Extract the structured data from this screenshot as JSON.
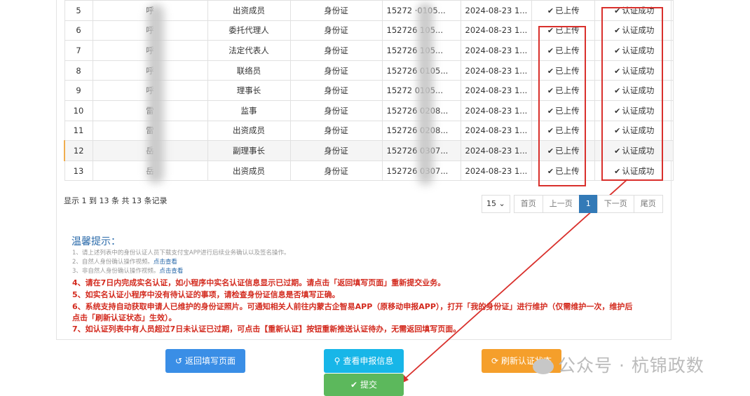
{
  "table": {
    "rows": [
      {
        "no": "5",
        "name": "呼",
        "role": "出资成员",
        "idtype": "身份证",
        "idno": "15272 ·0105...",
        "date": "2024-08-23 1...",
        "upload": "已上传",
        "auth": "认证成功"
      },
      {
        "no": "6",
        "name": "呼",
        "role": "委托代理人",
        "idtype": "身份证",
        "idno": "152726 105...",
        "date": "2024-08-23 1...",
        "upload": "已上传",
        "auth": "认证成功"
      },
      {
        "no": "7",
        "name": "呼",
        "role": "法定代表人",
        "idtype": "身份证",
        "idno": "152726 105...",
        "date": "2024-08-23 1...",
        "upload": "已上传",
        "auth": "认证成功"
      },
      {
        "no": "8",
        "name": "呼",
        "role": "联络员",
        "idtype": "身份证",
        "idno": "152726 0105...",
        "date": "2024-08-23 1...",
        "upload": "已上传",
        "auth": "认证成功"
      },
      {
        "no": "9",
        "name": "呼",
        "role": "理事长",
        "idtype": "身份证",
        "idno": "15272 0105...",
        "date": "2024-08-23 1...",
        "upload": "已上传",
        "auth": "认证成功"
      },
      {
        "no": "10",
        "name": "雷",
        "role": "监事",
        "idtype": "身份证",
        "idno": "152726 0208...",
        "date": "2024-08-23 1...",
        "upload": "已上传",
        "auth": "认证成功"
      },
      {
        "no": "11",
        "name": "雷",
        "role": "出资成员",
        "idtype": "身份证",
        "idno": "152726 0208...",
        "date": "2024-08-23 1...",
        "upload": "已上传",
        "auth": "认证成功"
      },
      {
        "no": "12",
        "name": "岳",
        "role": "副理事长",
        "idtype": "身份证",
        "idno": "152726 0307...",
        "date": "2024-08-23 1...",
        "upload": "已上传",
        "auth": "认证成功"
      },
      {
        "no": "13",
        "name": "岳",
        "role": "出资成员",
        "idtype": "身份证",
        "idno": "152726 0307...",
        "date": "2024-08-23 1...",
        "upload": "已上传",
        "auth": "认证成功"
      }
    ]
  },
  "pagination": {
    "info": "显示 1 到 13 条 共 13 条记录",
    "page_size": "15",
    "first": "首页",
    "prev": "上一页",
    "current": "1",
    "next": "下一页",
    "last": "尾页"
  },
  "tips": {
    "title": "温馨提示：",
    "grey1": "1、请上述列表中的身份认证人员下载支付宝APP进行后续业务确认以及签名操作。",
    "grey2": "2、自然人身份确认操作视频。",
    "grey3": "3、非自然人身份确认操作视频。",
    "link": "点击查看",
    "red4": "4、请在7日内完成实名认证，如小程序中实名认证信息显示已过期。请点击「返回填写页面」重新提交业务。",
    "red5": "5、如实名认证小程序中没有待认证的事项，请检查身份证信息是否填写正确。",
    "red6a": "6、系统支持自动获取申请人已维护的身份证照片。可通知相关人前往内蒙古企智易APP（原移动申报APP），打开「我的身份证」进行维护（仅需维护一次，维护后",
    "red6b": "点击「刷新认证状态」生效）。",
    "red7": "7、如认证列表中有人员超过7日未认证已过期，可点击【重新认证】按钮重新推送认证待办，无需返回填写页面。"
  },
  "buttons": {
    "back": "返回填写页面",
    "view": "查看申报信息",
    "refresh": "刷新认证状态",
    "submit": "提交"
  },
  "watermark": "公众号 · 杭锦政数",
  "colors": {
    "primary": "#3a8ee6",
    "info": "#17b6e8",
    "warning": "#f59f2b",
    "success": "#5cb85c",
    "annotation_red": "#d9302c"
  }
}
